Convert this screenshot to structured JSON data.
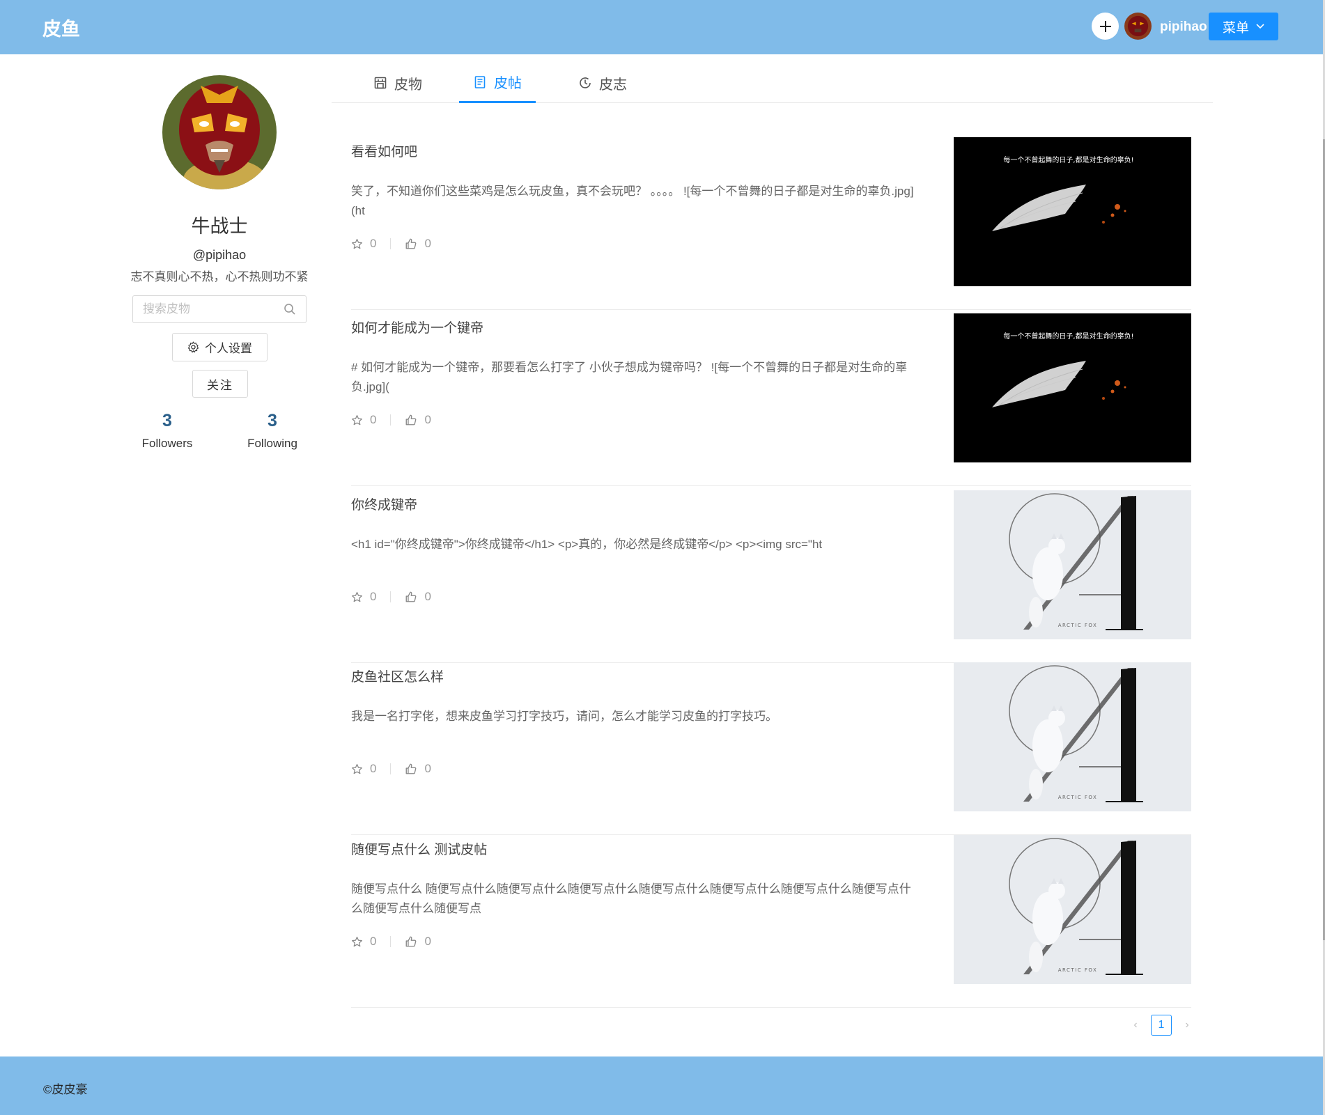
{
  "header": {
    "logo": "皮鱼",
    "username": "pipihao",
    "menu_label": "菜单"
  },
  "profile": {
    "name": "牛战士",
    "handle": "@pipihao",
    "motto": "志不真则心不热，心不热则功不紧",
    "search_placeholder": "搜索皮物",
    "settings_label": "个人设置",
    "follow_label": "关注",
    "followers_count": "3",
    "followers_label": "Followers",
    "following_count": "3",
    "following_label": "Following"
  },
  "tabs": [
    {
      "label": "皮物",
      "icon": "shop-icon"
    },
    {
      "label": "皮帖",
      "icon": "file-text-icon"
    },
    {
      "label": "皮志",
      "icon": "history-icon"
    }
  ],
  "posts": [
    {
      "title": "看看如何吧",
      "body": "笑了，不知道你们这些菜鸡是怎么玩皮鱼，真不会玩吧？ 。。。。 ![每一个不曾舞的日子都是对生命的辜负.jpg](ht",
      "stars": "0",
      "likes": "0",
      "image_caption": "每一个不曾起舞的日子,都是对生命的辜负!",
      "image_style": "dark-feather"
    },
    {
      "title": "如何才能成为一个键帝",
      "body": "# 如何才能成为一个键帝，那要看怎么打字了 小伙子想成为键帝吗？ ![每一个不曾舞的日子都是对生命的辜负.jpg](",
      "stars": "0",
      "likes": "0",
      "image_caption": "每一个不曾起舞的日子,都是对生命的辜负!",
      "image_style": "dark-feather"
    },
    {
      "title": "你终成键帝",
      "body": "<h1 id=\"你终成键帝\">你终成键帝</h1> <p>真的，你必然是终成键帝</p> <p><img src=\"ht",
      "stars": "0",
      "likes": "0",
      "image_caption": "ARCTIC FOX",
      "image_style": "arctic-fox"
    },
    {
      "title": "皮鱼社区怎么样",
      "body": "我是一名打字佬，想来皮鱼学习打字技巧，请问，怎么才能学习皮鱼的打字技巧。",
      "stars": "0",
      "likes": "0",
      "image_caption": "ARCTIC FOX",
      "image_style": "arctic-fox"
    },
    {
      "title": "随便写点什么 测试皮帖",
      "body": "随便写点什么 随便写点什么随便写点什么随便写点什么随便写点什么随便写点什么随便写点什么随便写点什么随便写点什么随便写点",
      "stars": "0",
      "likes": "0",
      "image_caption": "ARCTIC FOX",
      "image_style": "arctic-fox"
    }
  ],
  "pagination": {
    "current": "1"
  },
  "footer": {
    "copyright": "©皮皮豪"
  },
  "colors": {
    "header_bg": "#80bbe9",
    "accent": "#1890ff"
  }
}
